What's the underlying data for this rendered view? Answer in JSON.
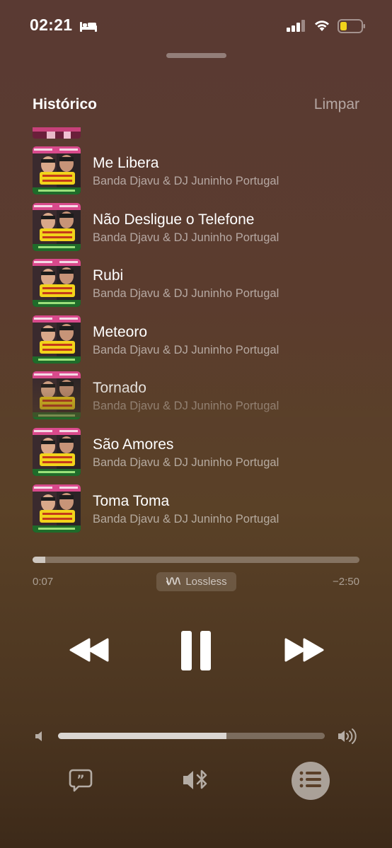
{
  "status_bar": {
    "time": "02:21",
    "icons": [
      "bed-icon",
      "cellular-signal-icon",
      "wifi-icon",
      "battery-low-icon"
    ]
  },
  "history": {
    "title": "Histórico",
    "clear_label": "Limpar",
    "album_art": "album-art-icon",
    "tracks": [
      {
        "title": "Me Libera",
        "artist": "Banda Djavu & DJ Juninho Portugal"
      },
      {
        "title": "Não Desligue o Telefone",
        "artist": "Banda Djavu & DJ Juninho Portugal"
      },
      {
        "title": "Rubi",
        "artist": "Banda Djavu & DJ Juninho Portugal"
      },
      {
        "title": "Meteoro",
        "artist": "Banda Djavu & DJ Juninho Portugal"
      },
      {
        "title": "Tornado",
        "artist": "Banda Djavu & DJ Juninho Portugal"
      },
      {
        "title": "São Amores",
        "artist": "Banda Djavu & DJ Juninho Portugal"
      },
      {
        "title": "Toma Toma",
        "artist": "Banda Djavu & DJ Juninho Portugal"
      }
    ]
  },
  "playback": {
    "elapsed": "0:07",
    "remaining": "−2:50",
    "progress_fraction": 0.04,
    "quality_label": "Lossless"
  },
  "controls": {
    "icons": [
      "rewind-icon",
      "pause-icon",
      "fast-forward-icon"
    ]
  },
  "volume": {
    "level_fraction": 0.63
  },
  "bottom_bar": {
    "icons": [
      "lyrics-icon",
      "airplay-bluetooth-icon",
      "queue-icon"
    ]
  },
  "colors": {
    "battery_fill": "#f2d31b",
    "album_pink": "#d94a8c",
    "album_yellow": "#f2d31b"
  }
}
